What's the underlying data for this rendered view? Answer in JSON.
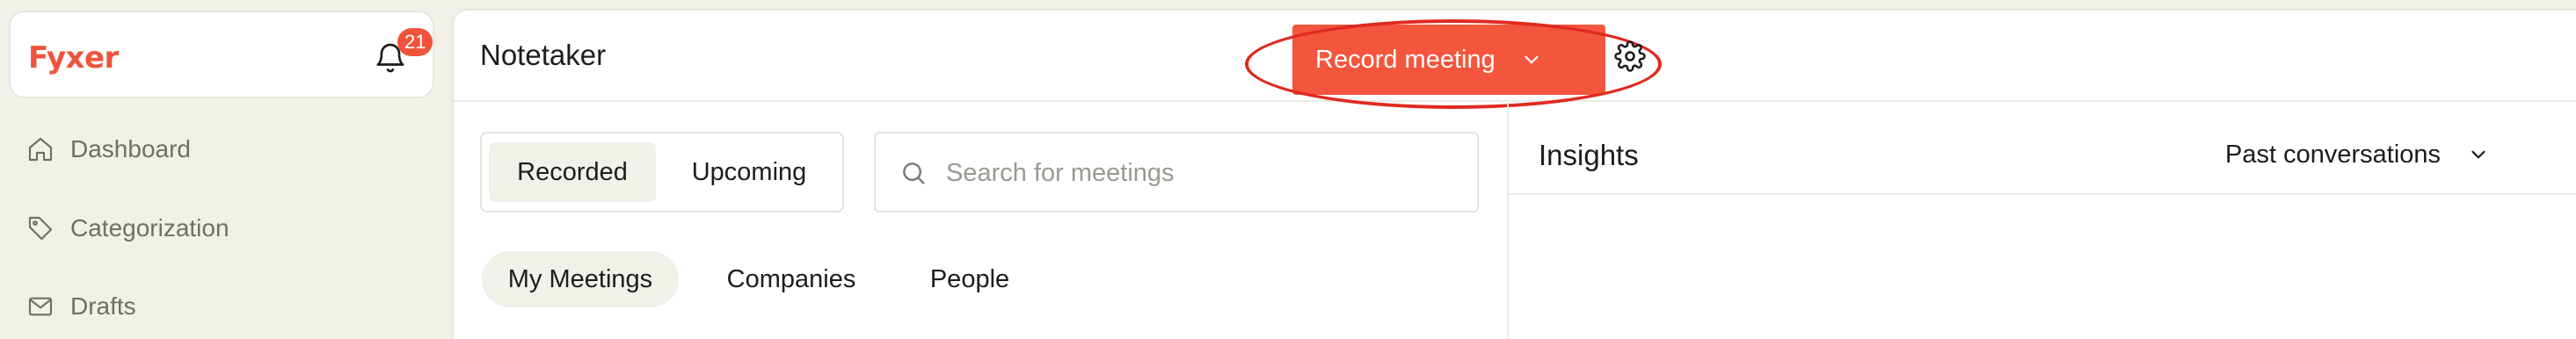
{
  "brand": {
    "logo": "Fyxer",
    "notification_count": "21"
  },
  "sidebar": {
    "items": [
      {
        "label": "Dashboard",
        "icon": "home-icon"
      },
      {
        "label": "Categorization",
        "icon": "tag-icon"
      },
      {
        "label": "Drafts",
        "icon": "mail-icon"
      }
    ]
  },
  "header": {
    "title": "Notetaker",
    "record_label": "Record meeting",
    "settings_icon": "gear-icon"
  },
  "meetings": {
    "segments": [
      "Recorded",
      "Upcoming"
    ],
    "active_segment": "Recorded",
    "search_placeholder": "Search for meetings",
    "search_value": "",
    "tabs": [
      "My Meetings",
      "Companies",
      "People"
    ],
    "active_tab": "My Meetings"
  },
  "insights": {
    "title": "Insights",
    "filter_value": "Past conversations"
  },
  "colors": {
    "accent": "#f4563d",
    "background": "#f1f1ea",
    "highlight_ring": "#e02a1f"
  }
}
